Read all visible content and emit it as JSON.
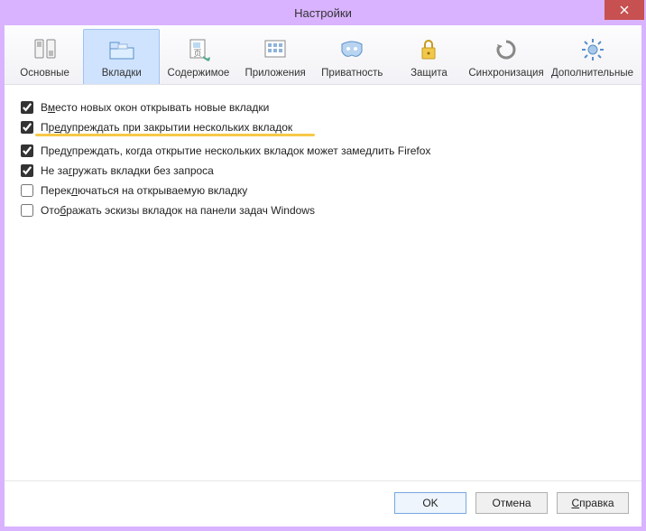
{
  "window": {
    "title": "Настройки"
  },
  "tabs": [
    {
      "id": "general",
      "label": "Основные"
    },
    {
      "id": "tabs",
      "label": "Вкладки"
    },
    {
      "id": "content",
      "label": "Содержимое"
    },
    {
      "id": "applications",
      "label": "Приложения"
    },
    {
      "id": "privacy",
      "label": "Приватность"
    },
    {
      "id": "security",
      "label": "Защита"
    },
    {
      "id": "sync",
      "label": "Синхронизация"
    },
    {
      "id": "advanced",
      "label": "Дополнительные"
    }
  ],
  "active_tab": "tabs",
  "options": [
    {
      "id": "open-new-tab",
      "checked": true,
      "label_pre": "В",
      "label_u": "м",
      "label_post": "есто новых окон открывать новые вкладки",
      "highlighted": false
    },
    {
      "id": "warn-close-multiple",
      "checked": true,
      "label_pre": "Пр",
      "label_u": "е",
      "label_post": "дупреждать при закрытии нескольких вкладок",
      "highlighted": true
    },
    {
      "id": "warn-open-many",
      "checked": true,
      "label_pre": "Пред",
      "label_u": "у",
      "label_post": "преждать, когда открытие нескольких вкладок может замедлить Firefox",
      "highlighted": false
    },
    {
      "id": "dont-load-until-selected",
      "checked": true,
      "label_pre": "Не за",
      "label_u": "г",
      "label_post": "ружать вкладки без запроса",
      "highlighted": false
    },
    {
      "id": "switch-to-new-tab",
      "checked": false,
      "label_pre": "Перек",
      "label_u": "л",
      "label_post": "ючаться на открываемую вкладку",
      "highlighted": false
    },
    {
      "id": "show-previews",
      "checked": false,
      "label_pre": "Ото",
      "label_u": "б",
      "label_post": "ражать эскизы вкладок на панели задач Windows",
      "highlighted": false
    }
  ],
  "buttons": {
    "ok": "OK",
    "cancel": "Отмена",
    "help_pre": "",
    "help_u": "С",
    "help_post": "правка"
  }
}
